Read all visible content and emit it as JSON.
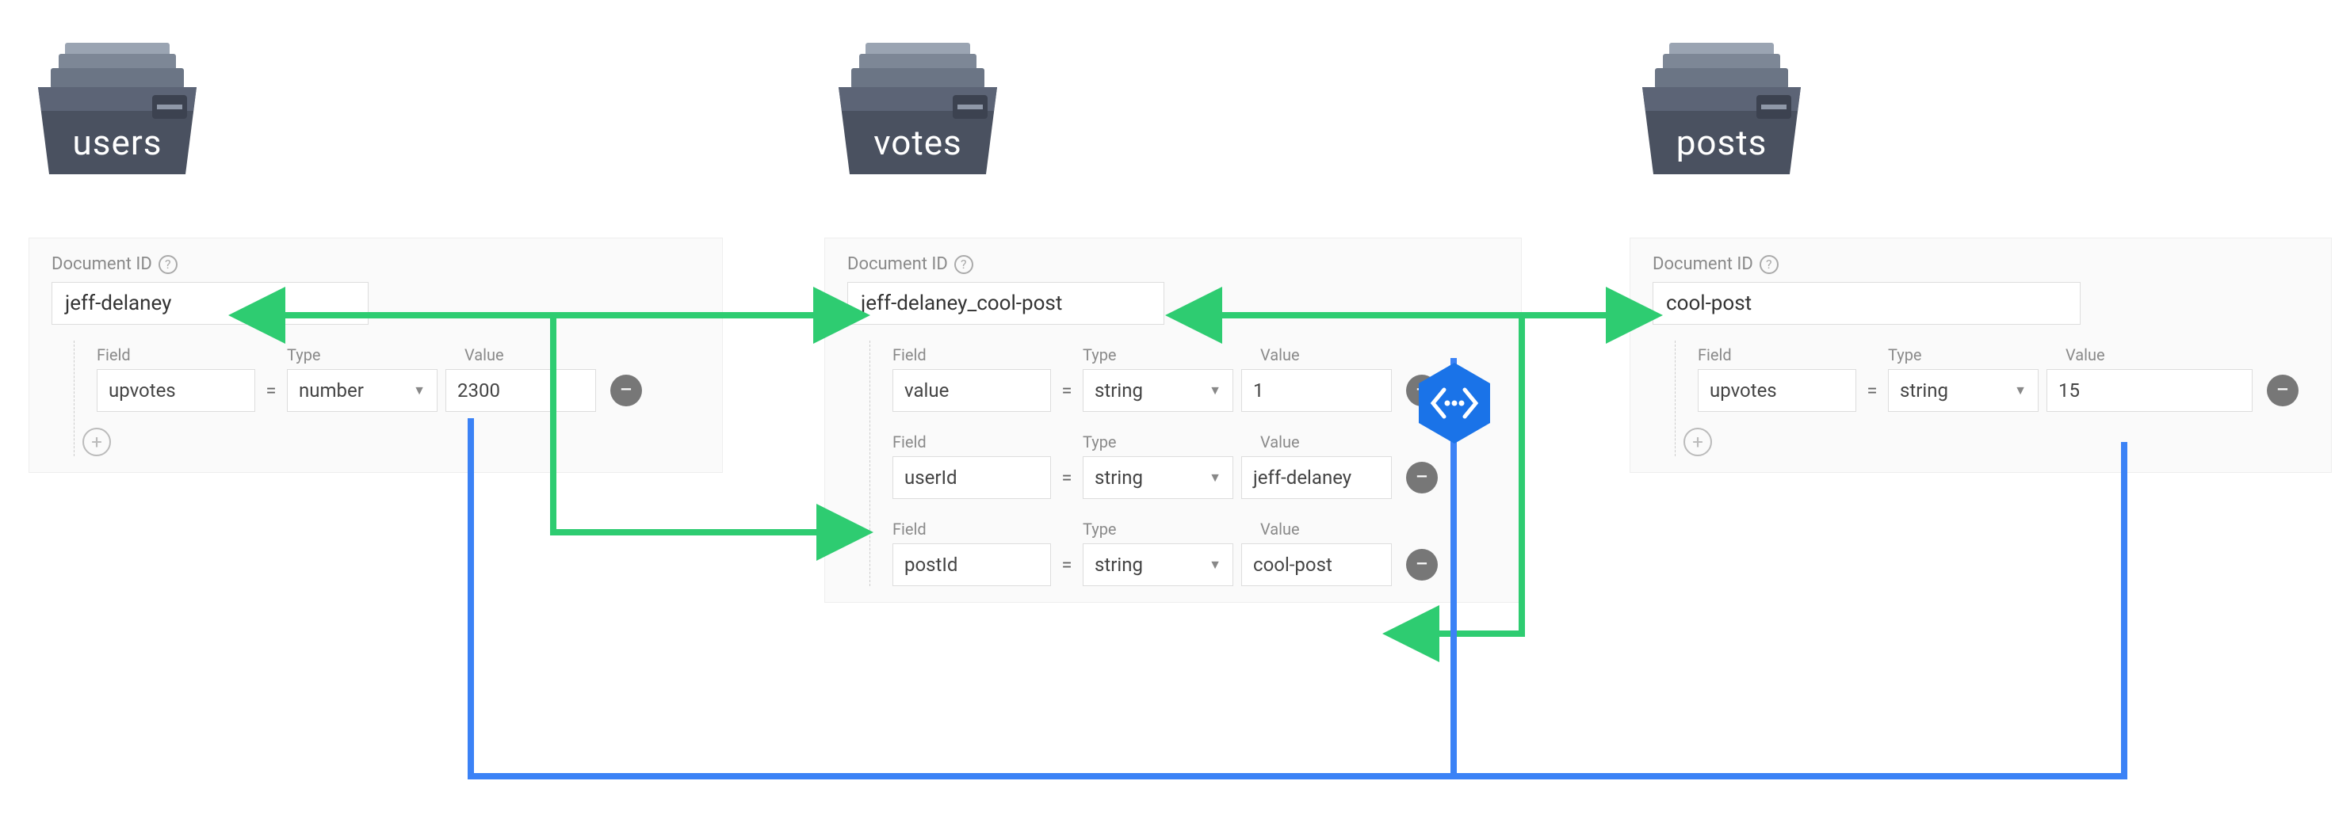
{
  "labels": {
    "document_id": "Document ID",
    "field": "Field",
    "type": "Type",
    "value": "Value"
  },
  "collections": {
    "users": {
      "title": "users",
      "doc_id": "jeff-delaney",
      "fields": [
        {
          "name": "upvotes",
          "type": "number",
          "value": "2300"
        }
      ]
    },
    "votes": {
      "title": "votes",
      "doc_id": "jeff-delaney_cool-post",
      "fields": [
        {
          "name": "value",
          "type": "string",
          "value": "1"
        },
        {
          "name": "userId",
          "type": "string",
          "value": "jeff-delaney"
        },
        {
          "name": "postId",
          "type": "string",
          "value": "cool-post"
        }
      ]
    },
    "posts": {
      "title": "posts",
      "doc_id": "cool-post",
      "fields": [
        {
          "name": "upvotes",
          "type": "string",
          "value": "15"
        }
      ]
    }
  },
  "colors": {
    "green": "#2ecc71",
    "blue": "#3b82f6"
  }
}
